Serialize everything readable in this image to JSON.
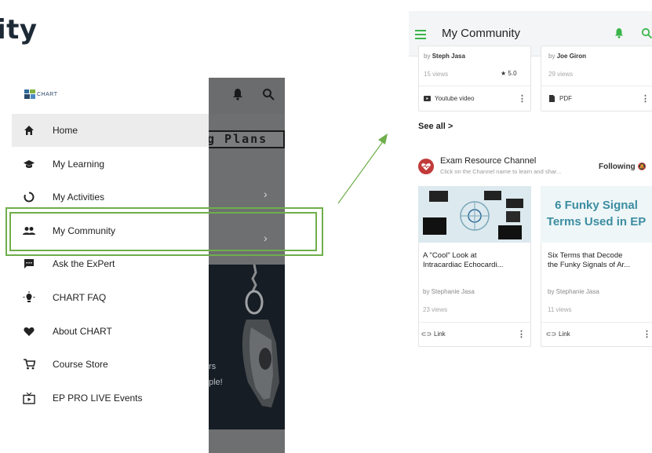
{
  "heading": "ity",
  "left_phone": {
    "logo_text": "CHART",
    "menu": [
      {
        "label": "Home",
        "icon": "home-icon",
        "active": true
      },
      {
        "label": "My Learning",
        "icon": "graduation-cap-icon",
        "active": false
      },
      {
        "label": "My Activities",
        "icon": "activity-ring-icon",
        "active": false
      },
      {
        "label": "My Community",
        "icon": "people-icon",
        "active": false
      },
      {
        "label": "Ask the ExPert",
        "icon": "chat-bubble-icon",
        "active": false
      },
      {
        "label": "CHART FAQ",
        "icon": "lightbulb-icon",
        "active": false
      },
      {
        "label": "About CHART",
        "icon": "heart-icon",
        "active": false
      },
      {
        "label": "Course Store",
        "icon": "cart-icon",
        "active": false
      },
      {
        "label": "EP PRO LIVE Events",
        "icon": "tv-icon",
        "active": false
      }
    ],
    "background": {
      "banner_text": "g Plans",
      "text_line1": "rs",
      "text_line2": "ple!"
    }
  },
  "right_phone": {
    "title": "My Community",
    "cards_top": [
      {
        "author_prefix": "by",
        "author": "Steph Jasa",
        "views": "15 views",
        "rating": "5.0",
        "type": "Youtube video"
      },
      {
        "author_prefix": "by",
        "author": "Joe Giron",
        "views": "29 views",
        "type": "PDF"
      }
    ],
    "see_all": "See all  >",
    "channel": {
      "name": "Exam Resource Channel",
      "description": "Click on the Channel name to learn and shar...",
      "following": "Following"
    },
    "cards_bottom": [
      {
        "thumb_text": "",
        "title_line1": "A \"Cool\" Look at",
        "title_line2": "Intracardiac Echocardi...",
        "author": "by Stephanie Jasa",
        "views": "23 views",
        "type": "Link"
      },
      {
        "thumb_text_line1": "6 Funky Signal",
        "thumb_text_line2": "Terms Used in EP",
        "title_line1": "Six Terms that Decode",
        "title_line2": "the Funky Signals of Ar...",
        "author": "by Stephanie Jasa",
        "views": "11 views",
        "type": "Link"
      }
    ]
  },
  "colors": {
    "highlight": "#6fae4b",
    "accent_green": "#3bb54a",
    "thumb_text": "#3c8da0"
  }
}
